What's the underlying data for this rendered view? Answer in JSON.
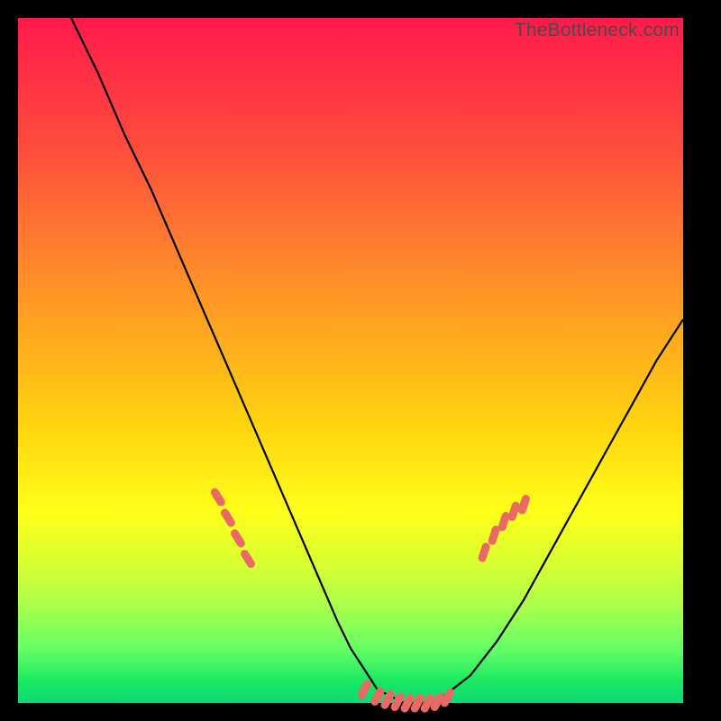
{
  "watermark": "TheBottleneck.com",
  "colors": {
    "frame": "#000000",
    "curve": "#000000",
    "markers": "#e86a63",
    "gradient_top": "#ff1a4b",
    "gradient_bottom": "#0bd977"
  },
  "chart_data": {
    "type": "line",
    "title": "",
    "xlabel": "",
    "ylabel": "",
    "xlim": [
      0,
      100
    ],
    "ylim": [
      0,
      100
    ],
    "grid": false,
    "legend": false,
    "series": [
      {
        "name": "bottleneck-curve",
        "x": [
          8,
          12,
          16,
          20,
          24,
          28,
          32,
          36,
          40,
          44,
          48,
          50,
          52,
          54,
          56,
          58,
          60,
          62,
          64,
          68,
          72,
          76,
          80,
          84,
          88,
          92,
          96,
          100
        ],
        "y": [
          100,
          92,
          83,
          75,
          66,
          57,
          48,
          39,
          30,
          21,
          12,
          8,
          5,
          2,
          1,
          0,
          0,
          0,
          1,
          4,
          9,
          15,
          22,
          29,
          36,
          43,
          50,
          56
        ]
      }
    ],
    "markers": {
      "name": "highlighted-points",
      "left_cluster": {
        "x": [
          30,
          31.5,
          33,
          34.5
        ],
        "y": [
          30,
          27,
          24,
          21
        ]
      },
      "floor_cluster": {
        "x": [
          52,
          54,
          55.5,
          57,
          58.5,
          60,
          61.5,
          63,
          64.5
        ],
        "y": [
          2,
          1,
          0.5,
          0.2,
          0,
          0,
          0,
          0.2,
          0.8
        ]
      },
      "right_cluster": {
        "x": [
          70,
          71.5,
          73,
          74.5,
          76
        ],
        "y": [
          22,
          24.5,
          26.5,
          28,
          29
        ]
      }
    }
  }
}
